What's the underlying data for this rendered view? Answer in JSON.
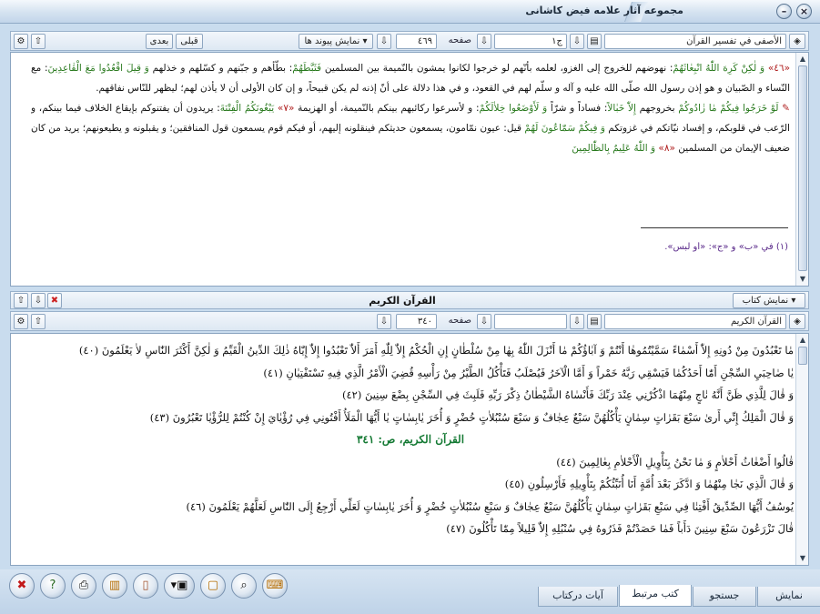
{
  "window": {
    "title": "مجموعه آثار علامه فيض كاشانى",
    "minimize_label": "–",
    "close_label": "×"
  },
  "top_toolbar": {
    "book_name": "الأصفى في تفسير القرآن",
    "volume_value": "ج١",
    "page_label": "صفحه",
    "page_value": "٤٦٩",
    "links_button": "نمايش پيوند ها",
    "prev_button": "قبلى",
    "next_button": "بعدى"
  },
  "commentary": {
    "p1_num": "«٤٦»",
    "p1_q1": "وَ لٰكِنْ كَرِهَ اللّٰهُ انْبِعٰاثَهُمْ",
    "p1_t1": ": نهوضهم للخروج إلى الغزو، لعلمه بأنّهم لو خرجوا لكانوا يمشون بالنّميمة بين المسلمين",
    "p1_q2": "فَثَبَّطَهُمْ",
    "p1_t2": ": بطّأهم و جبّنهم و كسّلهم و خذلهم",
    "p1_q3": "وَ قِيلَ اقْعُدُوا مَعَ الْقٰاعِدِينَ",
    "p1_t3": ": مع النّساء و الصّبيان و هو إذن رسول الله صلّى الله عليه و آله و سلّم لهم في القعود، و في هذا دلالة على أنّ إذنه لم يكن قبيحاً، و إن كان الأولى أن لا يأذن لهم؛ ليظهر للنّاس نفاقهم.",
    "p2_q1": "لَوْ خَرَجُوا فِيكُمْ مٰا زٰادُوكُمْ",
    "p2_t1": "بخروجهم",
    "p2_q2": "إِلاّٰ خَبٰالاً",
    "p2_t2": ": فساداً و شرّاً",
    "p2_q3": "وَ لَأَوْضَعُوا خِلاٰلَكُمْ",
    "p2_t3": ": و لأسرعوا ركائبهم بينكم بالنّميمة، أو الهزيمة",
    "p2_num": "«٧»",
    "p2_q4": "يَبْغُونَكُمُ الْفِتْنَةَ",
    "p2_t4": ": يريدون أن يفتنوكم بإيقاع الخلاف فيما بينكم، و الرّعب في قلوبكم، و إفساد نيّاتكم في غزوتكم",
    "p2_q5": "وَ فِيكُمْ سَمّٰاعُونَ لَهُمْ",
    "p2_t5": "قيل: عيون نمّامون، يسمعون حديثكم فينقلونه إليهم، أو فيكم قوم يسمعون قول المنافقين؛ و يقبلونه و يطيعونهم؛ يريد من كان ضعيف الإيمان من المسلمين",
    "p2_num2": "«٨»",
    "p2_q6": "وَ اللّٰهُ عَلِيمٌ بِالظّٰالِمِينَ",
    "footnote": "(١) في «ب» و «ج»: «أو لبس»."
  },
  "middle_bar": {
    "show_book_button": "نمايش كتاب",
    "title": "القرآن الكريم"
  },
  "bottom_toolbar": {
    "book_name": "القرآن الكريم",
    "page_label": "صفحه",
    "page_value": "٣٤٠"
  },
  "quran": {
    "lines": [
      "مٰا تَعْبُدُونَ مِنْ دُونِهِ إِلاّٰ أَسْمٰاءً سَمَّيْتُمُوهٰا أَنْتُمْ وَ آبٰاؤُكُمْ مٰا أَنْزَلَ اللّٰهُ بِهٰا مِنْ سُلْطٰانٍ إِنِ الْحُكْمُ إِلاّٰ لِلّٰهِ أَمَرَ أَلاّٰ تَعْبُدُوا إِلاّٰ إِيّٰاهُ ذٰلِكَ الدِّينُ الْقَيِّمُ وَ لٰكِنَّ أَكْثَرَ النّٰاسِ لاٰ يَعْلَمُونَ (٤٠)",
      "يٰا صٰاحِبَيِ السِّجْنِ أَمّٰا أَحَدُكُمٰا فَيَسْقِي رَبَّهُ خَمْراً وَ أَمَّا الْآخَرُ فَيُصْلَبُ فَتَأْكُلُ الطَّيْرُ مِنْ رَأْسِهِ قُضِيَ الْأَمْرُ الَّذِي فِيهِ تَسْتَفْتِيٰانِ (٤١)",
      "وَ قٰالَ لِلَّذِي ظَنَّ أَنَّهُ نٰاجٍ مِنْهُمَا اذْكُرْنِي عِنْدَ رَبِّكَ فَأَنْسٰاهُ الشَّيْطٰانُ ذِكْرَ رَبِّهِ فَلَبِثَ فِي السِّجْنِ بِضْعَ سِنِينَ (٤٢)",
      "وَ قٰالَ الْمَلِكُ إِنِّي أَرىٰ سَبْعَ بَقَرٰاتٍ سِمٰانٍ يَأْكُلُهُنَّ سَبْعٌ عِجٰافٌ وَ سَبْعَ سُنْبُلاٰتٍ خُضْرٍ وَ أُخَرَ يٰابِسٰاتٍ يٰا أَيُّهَا الْمَلَأُ أَفْتُونِي فِي رُؤْيٰايَ إِنْ كُنْتُمْ لِلرُّؤْيٰا تَعْبُرُونَ (٤٣)"
    ],
    "page_heading": "القرآن الكريم، ص: ٣٤١",
    "lines2": [
      "قٰالُوا أَضْغٰاثُ أَحْلاٰمٍ وَ مٰا نَحْنُ بِتَأْوِيلِ الْأَحْلاٰمِ بِعٰالِمِينَ (٤٤)",
      "وَ قٰالَ الَّذِي نَجٰا مِنْهُمٰا وَ ادَّكَرَ بَعْدَ أُمَّةٍ أَنَا أُنَبِّئُكُمْ بِتَأْوِيلِهِ فَأَرْسِلُونِ (٤٥)",
      "يُوسُفُ أَيُّهَا الصِّدِّيقُ أَفْتِنٰا فِي سَبْعِ بَقَرٰاتٍ سِمٰانٍ يَأْكُلُهُنَّ سَبْعٌ عِجٰافٌ وَ سَبْعِ سُنْبُلاٰتٍ خُضْرٍ وَ أُخَرَ يٰابِسٰاتٍ لَعَلِّي أَرْجِعُ إِلَى النّٰاسِ لَعَلَّهُمْ يَعْلَمُونَ (٤٦)",
      "قٰالَ تَزْرَعُونَ سَبْعَ سِنِينَ دَأَباً فَمٰا حَصَدْتُمْ فَذَرُوهُ فِي سُنْبُلِهِ إِلاّٰ قَلِيلاً مِمّٰا تَأْكُلُونَ (٤٧)"
    ]
  },
  "tabs": {
    "show": "نمايش",
    "search": "جستجو",
    "linked_book": "كتب مرتبط",
    "verses_in_book": "آيات دركتاب"
  },
  "colors": {
    "accent": "#2a7a1f",
    "verse_number": "#b02020",
    "page_heading": "#157a34"
  }
}
